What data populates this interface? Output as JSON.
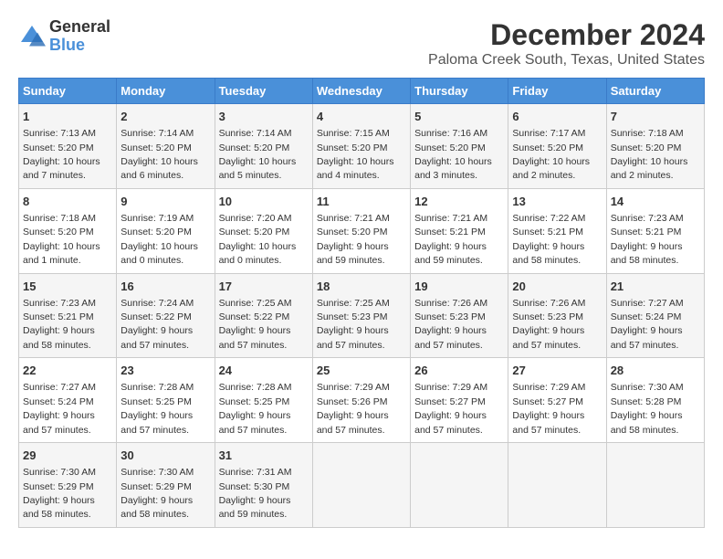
{
  "logo": {
    "general": "General",
    "blue": "Blue"
  },
  "title": "December 2024",
  "subtitle": "Paloma Creek South, Texas, United States",
  "headers": [
    "Sunday",
    "Monday",
    "Tuesday",
    "Wednesday",
    "Thursday",
    "Friday",
    "Saturday"
  ],
  "weeks": [
    [
      {
        "day": "1",
        "sunrise": "Sunrise: 7:13 AM",
        "sunset": "Sunset: 5:20 PM",
        "daylight": "Daylight: 10 hours and 7 minutes."
      },
      {
        "day": "2",
        "sunrise": "Sunrise: 7:14 AM",
        "sunset": "Sunset: 5:20 PM",
        "daylight": "Daylight: 10 hours and 6 minutes."
      },
      {
        "day": "3",
        "sunrise": "Sunrise: 7:14 AM",
        "sunset": "Sunset: 5:20 PM",
        "daylight": "Daylight: 10 hours and 5 minutes."
      },
      {
        "day": "4",
        "sunrise": "Sunrise: 7:15 AM",
        "sunset": "Sunset: 5:20 PM",
        "daylight": "Daylight: 10 hours and 4 minutes."
      },
      {
        "day": "5",
        "sunrise": "Sunrise: 7:16 AM",
        "sunset": "Sunset: 5:20 PM",
        "daylight": "Daylight: 10 hours and 3 minutes."
      },
      {
        "day": "6",
        "sunrise": "Sunrise: 7:17 AM",
        "sunset": "Sunset: 5:20 PM",
        "daylight": "Daylight: 10 hours and 2 minutes."
      },
      {
        "day": "7",
        "sunrise": "Sunrise: 7:18 AM",
        "sunset": "Sunset: 5:20 PM",
        "daylight": "Daylight: 10 hours and 2 minutes."
      }
    ],
    [
      {
        "day": "8",
        "sunrise": "Sunrise: 7:18 AM",
        "sunset": "Sunset: 5:20 PM",
        "daylight": "Daylight: 10 hours and 1 minute."
      },
      {
        "day": "9",
        "sunrise": "Sunrise: 7:19 AM",
        "sunset": "Sunset: 5:20 PM",
        "daylight": "Daylight: 10 hours and 0 minutes."
      },
      {
        "day": "10",
        "sunrise": "Sunrise: 7:20 AM",
        "sunset": "Sunset: 5:20 PM",
        "daylight": "Daylight: 10 hours and 0 minutes."
      },
      {
        "day": "11",
        "sunrise": "Sunrise: 7:21 AM",
        "sunset": "Sunset: 5:20 PM",
        "daylight": "Daylight: 9 hours and 59 minutes."
      },
      {
        "day": "12",
        "sunrise": "Sunrise: 7:21 AM",
        "sunset": "Sunset: 5:21 PM",
        "daylight": "Daylight: 9 hours and 59 minutes."
      },
      {
        "day": "13",
        "sunrise": "Sunrise: 7:22 AM",
        "sunset": "Sunset: 5:21 PM",
        "daylight": "Daylight: 9 hours and 58 minutes."
      },
      {
        "day": "14",
        "sunrise": "Sunrise: 7:23 AM",
        "sunset": "Sunset: 5:21 PM",
        "daylight": "Daylight: 9 hours and 58 minutes."
      }
    ],
    [
      {
        "day": "15",
        "sunrise": "Sunrise: 7:23 AM",
        "sunset": "Sunset: 5:21 PM",
        "daylight": "Daylight: 9 hours and 58 minutes."
      },
      {
        "day": "16",
        "sunrise": "Sunrise: 7:24 AM",
        "sunset": "Sunset: 5:22 PM",
        "daylight": "Daylight: 9 hours and 57 minutes."
      },
      {
        "day": "17",
        "sunrise": "Sunrise: 7:25 AM",
        "sunset": "Sunset: 5:22 PM",
        "daylight": "Daylight: 9 hours and 57 minutes."
      },
      {
        "day": "18",
        "sunrise": "Sunrise: 7:25 AM",
        "sunset": "Sunset: 5:23 PM",
        "daylight": "Daylight: 9 hours and 57 minutes."
      },
      {
        "day": "19",
        "sunrise": "Sunrise: 7:26 AM",
        "sunset": "Sunset: 5:23 PM",
        "daylight": "Daylight: 9 hours and 57 minutes."
      },
      {
        "day": "20",
        "sunrise": "Sunrise: 7:26 AM",
        "sunset": "Sunset: 5:23 PM",
        "daylight": "Daylight: 9 hours and 57 minutes."
      },
      {
        "day": "21",
        "sunrise": "Sunrise: 7:27 AM",
        "sunset": "Sunset: 5:24 PM",
        "daylight": "Daylight: 9 hours and 57 minutes."
      }
    ],
    [
      {
        "day": "22",
        "sunrise": "Sunrise: 7:27 AM",
        "sunset": "Sunset: 5:24 PM",
        "daylight": "Daylight: 9 hours and 57 minutes."
      },
      {
        "day": "23",
        "sunrise": "Sunrise: 7:28 AM",
        "sunset": "Sunset: 5:25 PM",
        "daylight": "Daylight: 9 hours and 57 minutes."
      },
      {
        "day": "24",
        "sunrise": "Sunrise: 7:28 AM",
        "sunset": "Sunset: 5:25 PM",
        "daylight": "Daylight: 9 hours and 57 minutes."
      },
      {
        "day": "25",
        "sunrise": "Sunrise: 7:29 AM",
        "sunset": "Sunset: 5:26 PM",
        "daylight": "Daylight: 9 hours and 57 minutes."
      },
      {
        "day": "26",
        "sunrise": "Sunrise: 7:29 AM",
        "sunset": "Sunset: 5:27 PM",
        "daylight": "Daylight: 9 hours and 57 minutes."
      },
      {
        "day": "27",
        "sunrise": "Sunrise: 7:29 AM",
        "sunset": "Sunset: 5:27 PM",
        "daylight": "Daylight: 9 hours and 57 minutes."
      },
      {
        "day": "28",
        "sunrise": "Sunrise: 7:30 AM",
        "sunset": "Sunset: 5:28 PM",
        "daylight": "Daylight: 9 hours and 58 minutes."
      }
    ],
    [
      {
        "day": "29",
        "sunrise": "Sunrise: 7:30 AM",
        "sunset": "Sunset: 5:29 PM",
        "daylight": "Daylight: 9 hours and 58 minutes."
      },
      {
        "day": "30",
        "sunrise": "Sunrise: 7:30 AM",
        "sunset": "Sunset: 5:29 PM",
        "daylight": "Daylight: 9 hours and 58 minutes."
      },
      {
        "day": "31",
        "sunrise": "Sunrise: 7:31 AM",
        "sunset": "Sunset: 5:30 PM",
        "daylight": "Daylight: 9 hours and 59 minutes."
      },
      null,
      null,
      null,
      null
    ]
  ]
}
